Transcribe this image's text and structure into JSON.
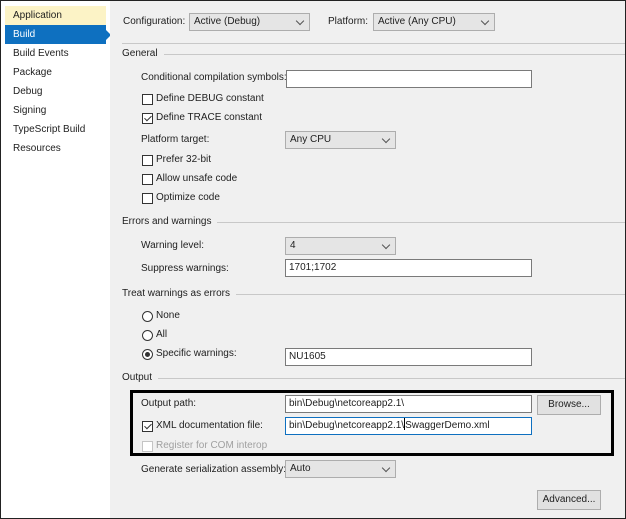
{
  "sidebar": {
    "items": [
      {
        "label": "Application",
        "state": "hover"
      },
      {
        "label": "Build",
        "state": "active"
      },
      {
        "label": "Build Events",
        "state": "normal"
      },
      {
        "label": "Package",
        "state": "normal"
      },
      {
        "label": "Debug",
        "state": "normal"
      },
      {
        "label": "Signing",
        "state": "normal"
      },
      {
        "label": "TypeScript Build",
        "state": "normal"
      },
      {
        "label": "Resources",
        "state": "normal"
      }
    ]
  },
  "header": {
    "configuration_label": "Configuration:",
    "configuration_value": "Active (Debug)",
    "platform_label": "Platform:",
    "platform_value": "Active (Any CPU)"
  },
  "general": {
    "title": "General",
    "conditional_symbols_label": "Conditional compilation symbols:",
    "conditional_symbols_value": "",
    "define_debug_label": "Define DEBUG constant",
    "define_debug_checked": false,
    "define_trace_label": "Define TRACE constant",
    "define_trace_checked": true,
    "platform_target_label": "Platform target:",
    "platform_target_value": "Any CPU",
    "prefer32_label": "Prefer 32-bit",
    "prefer32_checked": false,
    "unsafe_label": "Allow unsafe code",
    "unsafe_checked": false,
    "optimize_label": "Optimize code",
    "optimize_checked": false
  },
  "errors": {
    "title": "Errors and warnings",
    "warning_level_label": "Warning level:",
    "warning_level_value": "4",
    "suppress_label": "Suppress warnings:",
    "suppress_value": "1701;1702"
  },
  "treat": {
    "title": "Treat warnings as errors",
    "none_label": "None",
    "all_label": "All",
    "specific_label": "Specific warnings:",
    "selected": "specific",
    "specific_value": "NU1605"
  },
  "output": {
    "title": "Output",
    "output_path_label": "Output path:",
    "output_path_value": "bin\\Debug\\netcoreapp2.1\\",
    "browse_label": "Browse...",
    "xml_doc_label": "XML documentation file:",
    "xml_doc_checked": true,
    "xml_doc_value_before_caret": "bin\\Debug\\netcoreapp2.1\\",
    "xml_doc_value_after_caret": "SwaggerDemo.xml",
    "com_interop_label": "Register for COM interop",
    "com_interop_enabled": false,
    "serialization_label": "Generate serialization assembly:",
    "serialization_value": "Auto",
    "advanced_label": "Advanced..."
  }
}
